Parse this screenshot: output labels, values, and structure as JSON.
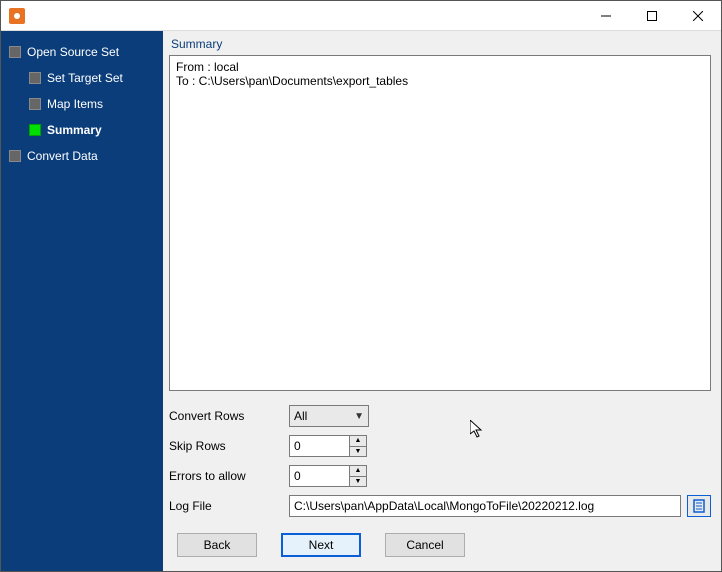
{
  "sidebar": {
    "items": [
      {
        "label": "Open Source Set",
        "level": 1,
        "active": false
      },
      {
        "label": "Set Target Set",
        "level": 2,
        "active": false
      },
      {
        "label": "Map Items",
        "level": 2,
        "active": false
      },
      {
        "label": "Summary",
        "level": 2,
        "active": true
      },
      {
        "label": "Convert Data",
        "level": 1,
        "active": false
      }
    ]
  },
  "main": {
    "section_title": "Summary",
    "summary_text": "From : local\nTo : C:\\Users\\pan\\Documents\\export_tables",
    "form": {
      "convert_rows": {
        "label": "Convert Rows",
        "value": "All"
      },
      "skip_rows": {
        "label": "Skip Rows",
        "value": "0"
      },
      "errors_allow": {
        "label": "Errors to allow",
        "value": "0"
      },
      "log_file": {
        "label": "Log File",
        "value": "C:\\Users\\pan\\AppData\\Local\\MongoToFile\\20220212.log"
      }
    }
  },
  "buttons": {
    "back": "Back",
    "next": "Next",
    "cancel": "Cancel"
  }
}
